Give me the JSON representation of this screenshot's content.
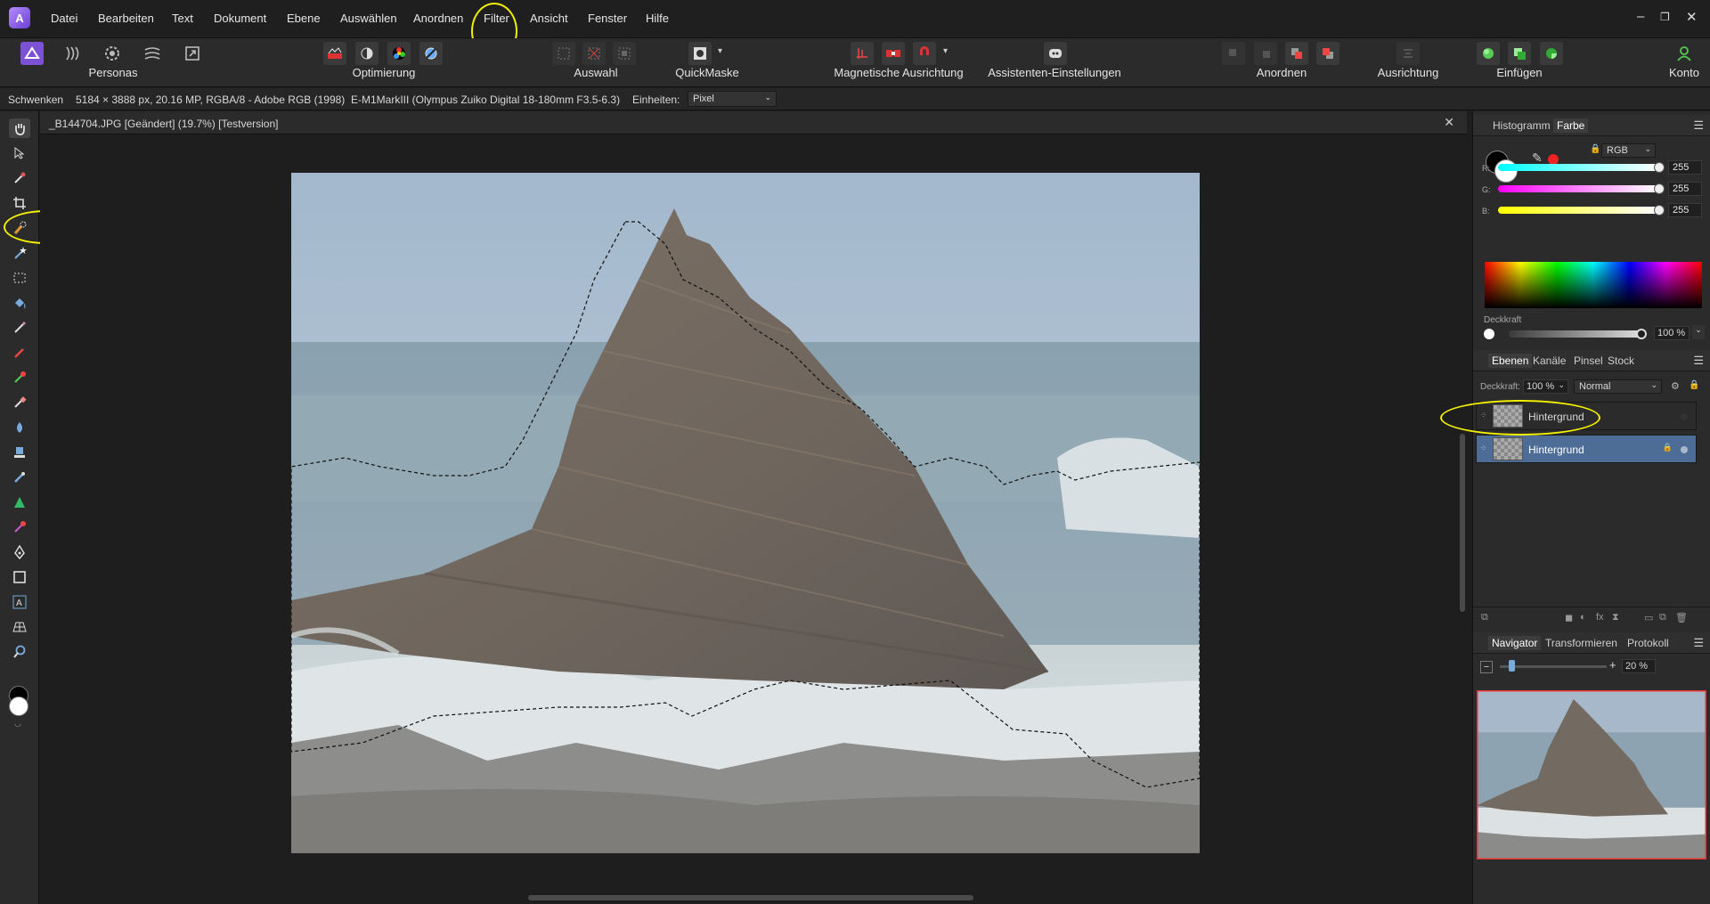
{
  "menu": {
    "items": [
      "Datei",
      "Bearbeiten",
      "Text",
      "Dokument",
      "Ebene",
      "Auswählen",
      "Anordnen",
      "Filter",
      "Ansicht",
      "Fenster",
      "Hilfe"
    ],
    "window_controls": [
      "–",
      "❐",
      "✕"
    ]
  },
  "toolbar": {
    "personas_label": "Personas",
    "optimierung_label": "Optimierung",
    "auswahl_label": "Auswahl",
    "quickmaske_label": "QuickMaske",
    "magnetische_label": "Magnetische Ausrichtung",
    "assistenten_label": "Assistenten-Einstellungen",
    "anordnen_label": "Anordnen",
    "ausrichtung_label": "Ausrichtung",
    "einfuegen_label": "Einfügen",
    "konto_label": "Konto"
  },
  "context": {
    "tool_name": "Schwenken",
    "image_info": "5184 × 3888 px, 20.16 MP, RGBA/8 - Adobe RGB (1998)",
    "camera_info": "E-M1MarkIII (Olympus Zuiko Digital 18-180mm F3.5-6.3)",
    "units_label": "Einheiten:",
    "units_value": "Pixel"
  },
  "document": {
    "tab_title": "_B144704.JPG [Geändert] (19.7%) [Testversion]",
    "close": "✕"
  },
  "color_panel": {
    "tabs": [
      "Histogramm",
      "Farbe"
    ],
    "active_tab": "Farbe",
    "mode": "RGB",
    "channels": [
      {
        "label": "R:",
        "value": "255"
      },
      {
        "label": "G:",
        "value": "255"
      },
      {
        "label": "B:",
        "value": "255"
      }
    ],
    "opacity_label": "Deckkraft",
    "opacity_value": "100 %"
  },
  "layers_panel": {
    "tabs": [
      "Ebenen",
      "Kanäle",
      "Pinsel",
      "Stock"
    ],
    "active_tab": "Ebenen",
    "opacity_label": "Deckkraft:",
    "opacity_value": "100 %",
    "blend_mode": "Normal",
    "layers": [
      {
        "name": "Hintergrund",
        "selected": false
      },
      {
        "name": "Hintergrund",
        "selected": true
      }
    ]
  },
  "navigator_panel": {
    "tabs": [
      "Navigator",
      "Transformieren",
      "Protokoll"
    ],
    "active_tab": "Navigator",
    "zoom_value": "20 %",
    "zoom_fraction": 0.2
  },
  "colors": {
    "accent": "#4a6ea0",
    "annotation": "#f3f000",
    "selected_layer": "#4e6d96"
  }
}
